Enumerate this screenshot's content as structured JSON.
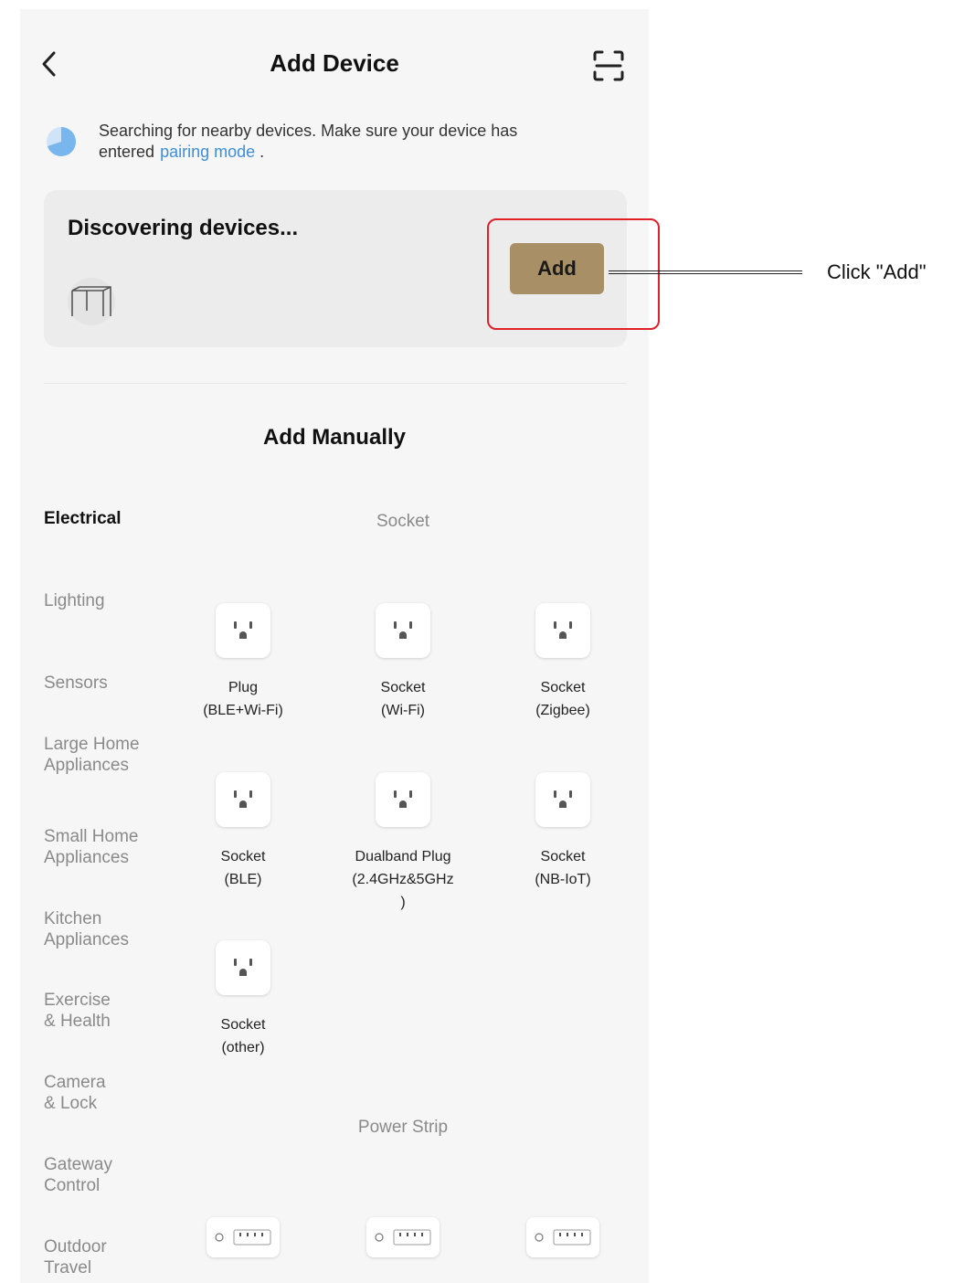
{
  "header": {
    "title": "Add Device",
    "back_icon": "chevron-left-icon",
    "scan_icon": "scan-icon"
  },
  "search_notice": {
    "text": "Searching for nearby devices. Make sure your device has entered",
    "link": "pairing mode",
    "suffix": "."
  },
  "discover_card": {
    "title": "Discovering devices...",
    "add_label": "Add"
  },
  "annotation": {
    "label": "Click \"Add\"",
    "highlight_color": "#e0202a"
  },
  "manual": {
    "title": "Add Manually"
  },
  "categories": [
    {
      "label": "Electrical",
      "active": true
    },
    {
      "label": "Lighting"
    },
    {
      "label": "Sensors"
    },
    {
      "label": "Large Home Appliances"
    },
    {
      "label": "Small Home Appliances"
    },
    {
      "label": "Kitchen Appliances"
    },
    {
      "label": "Exercise & Health"
    },
    {
      "label": "Camera & Lock"
    },
    {
      "label": "Gateway Control"
    },
    {
      "label": "Outdoor Travel"
    }
  ],
  "sections": [
    {
      "title": "Socket",
      "items": [
        {
          "line1": "Plug",
          "line2": "(BLE+Wi-Fi)"
        },
        {
          "line1": "Socket",
          "line2": "(Wi-Fi)"
        },
        {
          "line1": "Socket",
          "line2": "(Zigbee)"
        },
        {
          "line1": "Socket",
          "line2": "(BLE)"
        },
        {
          "line1": "Dualband Plug",
          "line2": "(2.4GHz&5GHz",
          "line3": ")"
        },
        {
          "line1": "Socket",
          "line2": "(NB-IoT)"
        },
        {
          "line1": "Socket",
          "line2": "(other)"
        }
      ]
    },
    {
      "title": "Power Strip"
    }
  ],
  "colors": {
    "accent": "#a88f66",
    "link": "#3b8fd9",
    "background": "#f6f6f6"
  }
}
